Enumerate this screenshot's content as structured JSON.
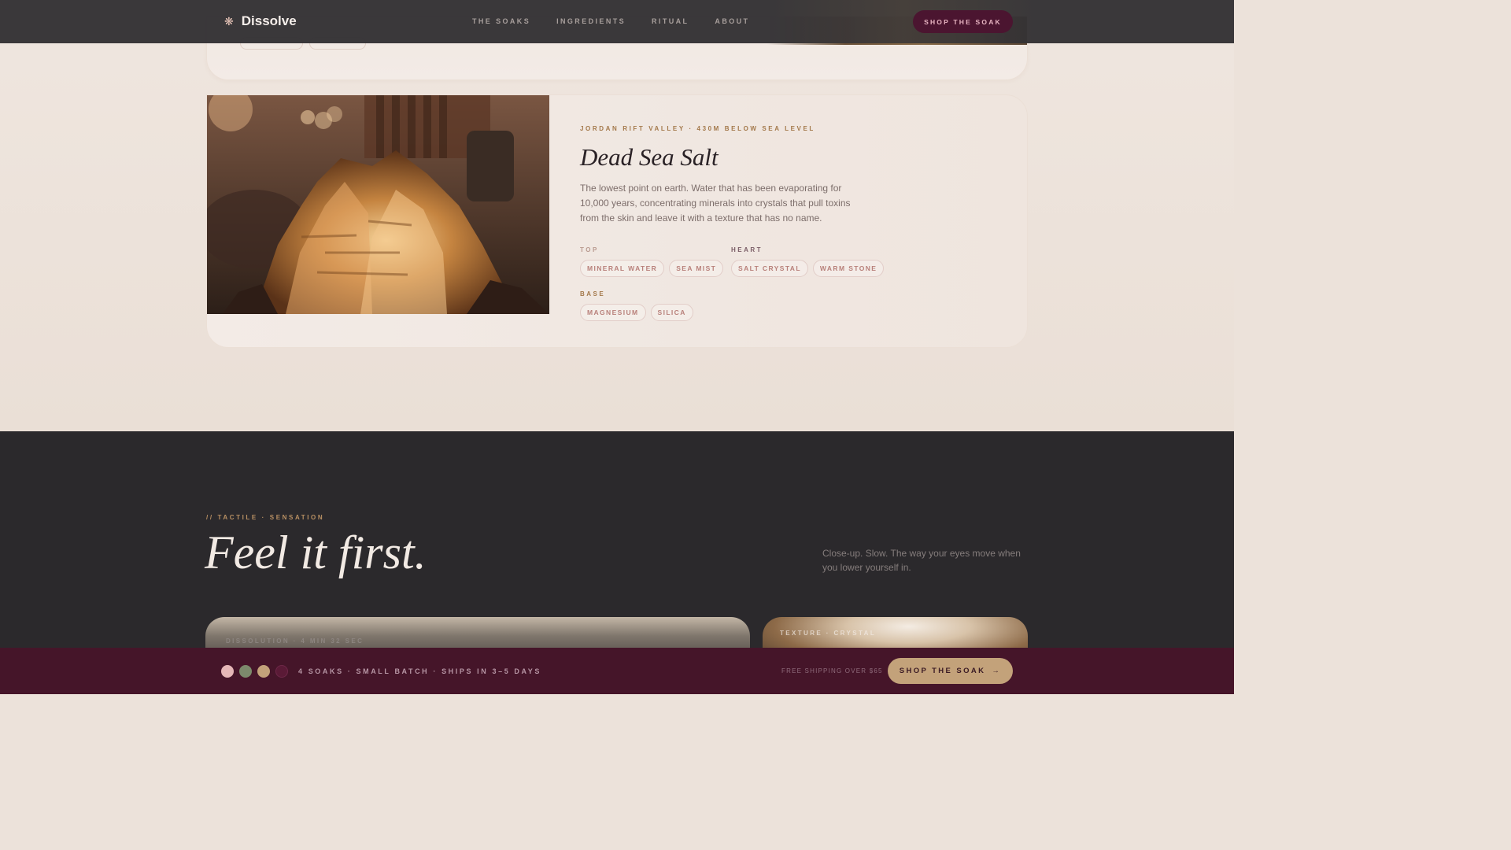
{
  "nav": {
    "brand": "Dissolve",
    "links": [
      "THE SOAKS",
      "INGREDIENTS",
      "RITUAL",
      "ABOUT"
    ],
    "cta": "SHOP THE SOAK",
    "logo_icon": "sun-flower-icon"
  },
  "ingredient": {
    "eyebrow": "JORDAN RIFT VALLEY · 430M BELOW SEA LEVEL",
    "title": "Dead Sea Salt",
    "description": "The lowest point on earth. Water that has been evaporating for 10,000 years, concentrating minerals into crystals that pull toxins from the skin and leave it with a texture that has no name.",
    "notes": {
      "top": {
        "label": "TOP",
        "chips": [
          "MINERAL WATER",
          "SEA MIST"
        ]
      },
      "heart": {
        "label": "HEART",
        "chips": [
          "SALT CRYSTAL",
          "WARM STONE"
        ]
      },
      "base": {
        "label": "BASE",
        "chips": [
          "MAGNESIUM",
          "SILICA"
        ]
      }
    }
  },
  "tactile": {
    "eyebrow": "// TACTILE · SENSATION",
    "title": "Feel it first.",
    "description": "Close-up. Slow. The way your eyes move when you lower yourself in.",
    "tile1_label": "DISSOLUTION · 4 MIN 32 SEC",
    "tile2_label": "TEXTURE · CRYSTAL"
  },
  "bottom_bar": {
    "summary": "4 SOAKS · SMALL BATCH · SHIPS IN 3–5 DAYS",
    "shipping": "FREE SHIPPING OVER $65",
    "cta": "SHOP THE SOAK",
    "cta_icon": "arrow-right-icon",
    "swatch_colors": [
      "#e5b7b7",
      "#7c8a6c",
      "#c3a27a",
      "#5a1a36"
    ]
  },
  "colors": {
    "accent_plum": "#451529",
    "accent_gold": "#c3a27a",
    "note_top": "#b99a8f",
    "note_heart": "#7a5d66",
    "note_base": "#a3784a"
  }
}
